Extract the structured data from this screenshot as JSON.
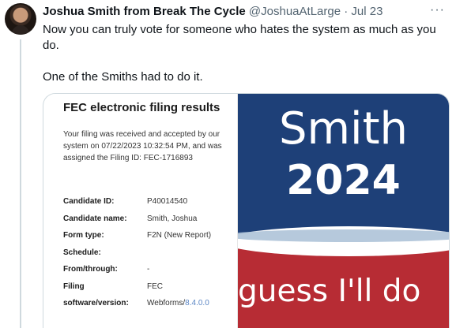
{
  "tweet": {
    "author_name": "Joshua Smith from Break The Cycle",
    "handle": "@JoshuaAtLarge",
    "separator": "·",
    "date": "Jul 23",
    "more_label": "···",
    "text_line1": "Now you can truly vote for someone who hates the system as much as you do.",
    "text_line2": "One of the Smiths had to do it."
  },
  "fec": {
    "title": "FEC electronic filing results",
    "message": "Your filing was received and accepted by our system on 07/22/2023 10:32:54 PM, and was assigned the Filing ID: FEC-1716893",
    "rows": [
      {
        "key": "Candidate ID:",
        "value": "P40014540"
      },
      {
        "key": "Candidate name:",
        "value": "Smith, Joshua"
      },
      {
        "key": "Form type:",
        "value": "F2N (New Report)"
      },
      {
        "key": "Schedule:",
        "value": ""
      },
      {
        "key": "From/through:",
        "value": "-"
      },
      {
        "key": "Filing",
        "value": "FEC"
      },
      {
        "key": "software/version:",
        "value": "Webforms/",
        "link": "8.4.0.0"
      }
    ]
  },
  "banner": {
    "name": "Smith",
    "year": "2024",
    "tagline": "guess I'll do",
    "colors": {
      "top": "#1e4078",
      "bottom": "#b72c34"
    }
  }
}
